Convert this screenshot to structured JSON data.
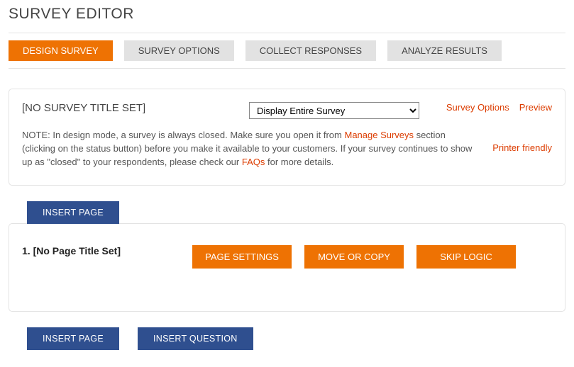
{
  "title": "SURVEY EDITOR",
  "tabs": {
    "design": "DESIGN SURVEY",
    "options": "SURVEY OPTIONS",
    "collect": "COLLECT RESPONSES",
    "analyze": "ANALYZE RESULTS"
  },
  "panel": {
    "surveyTitle": "[NO SURVEY TITLE SET]",
    "displaySelect": "Display Entire Survey",
    "links": {
      "surveyOptions": "Survey Options",
      "preview": "Preview",
      "printerFriendly": "Printer friendly"
    },
    "note": {
      "p1": "NOTE: In design mode, a survey is always closed. Make sure you open it from ",
      "manageSurveys": "Manage Surveys",
      "p2": " section (clicking on the status button) before you make it available to your customers. If your survey continues to show up as \"closed\" to your respondents, please check our ",
      "faqs": "FAQs",
      "p3": " for more details."
    }
  },
  "buttons": {
    "insertPage": "INSERT PAGE",
    "insertQuestion": "INSERT QUESTION",
    "pageSettings": "PAGE SETTINGS",
    "moveOrCopy": "MOVE OR COPY",
    "skipLogic": "SKIP LOGIC"
  },
  "page": {
    "label": "1. [No Page Title Set]"
  }
}
